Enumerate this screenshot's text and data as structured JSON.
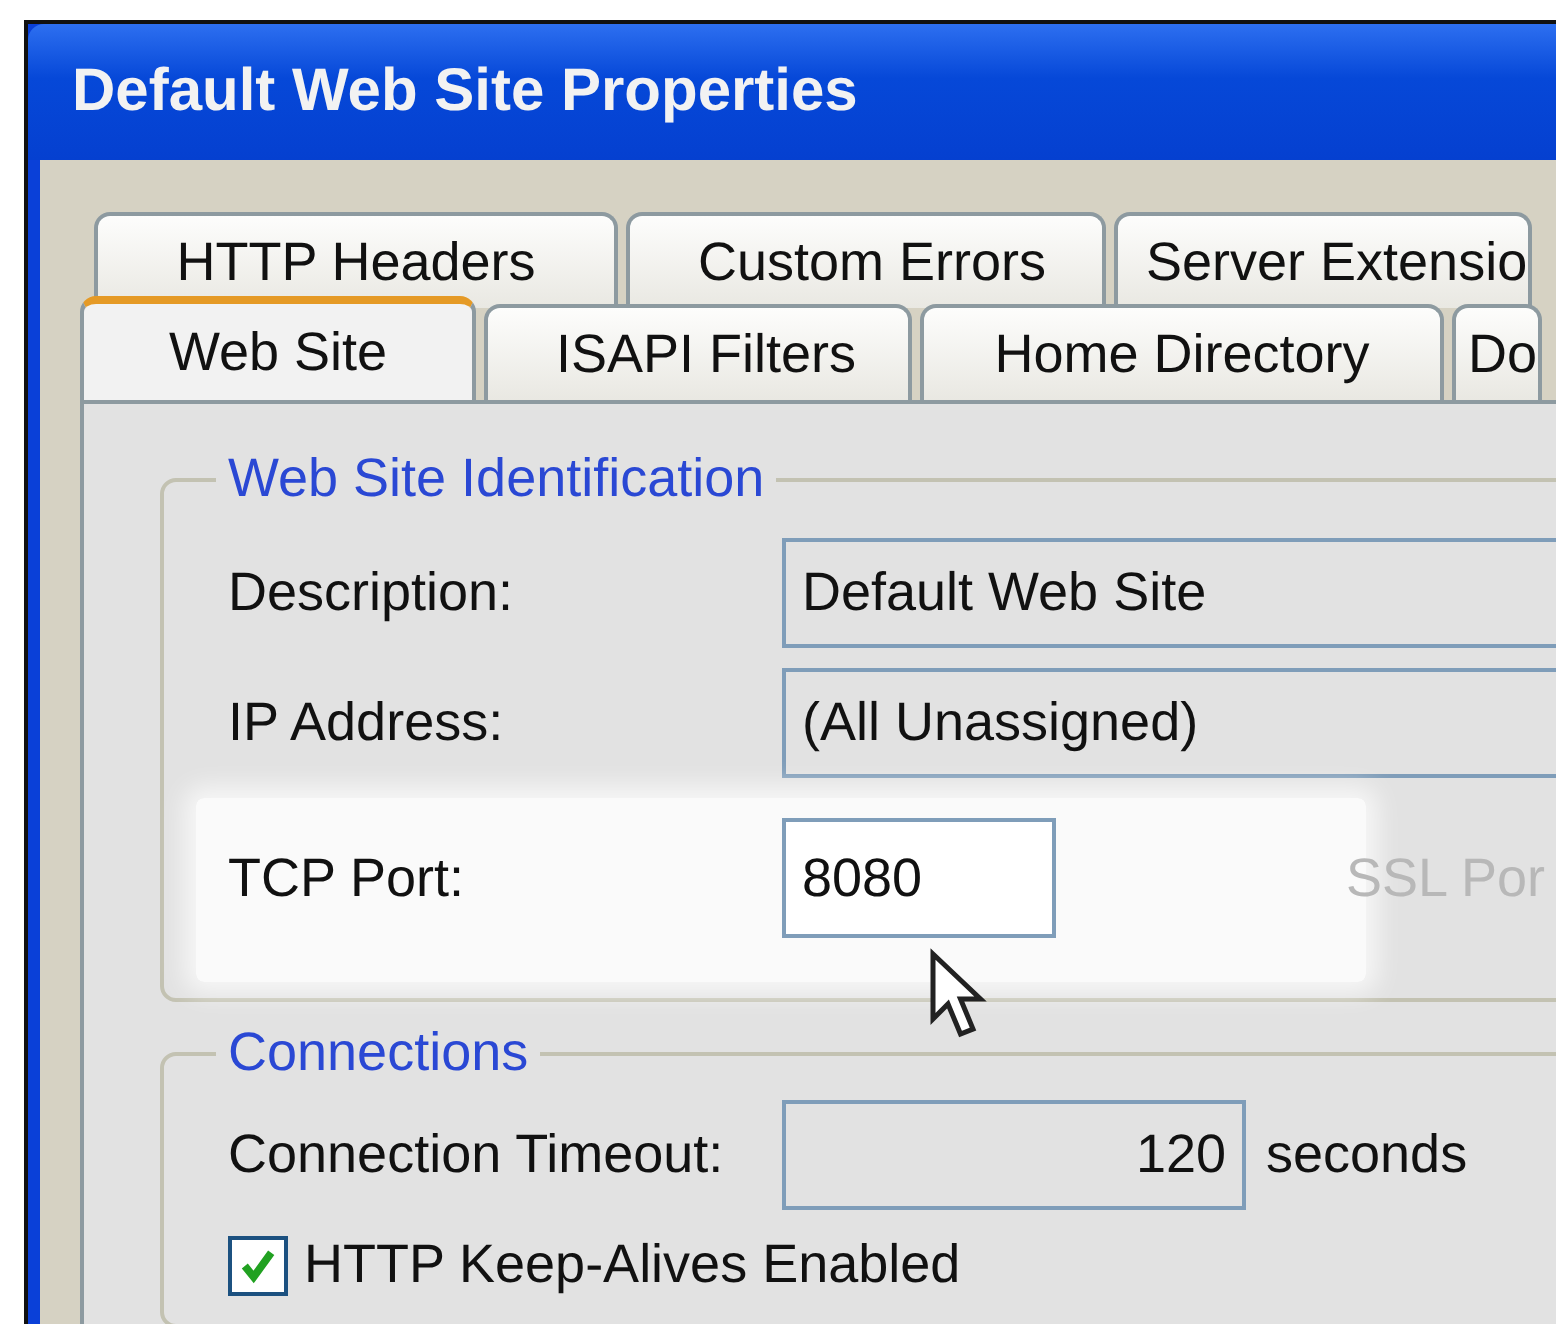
{
  "window": {
    "title": "Default Web Site Properties"
  },
  "tab_rows": [
    [
      {
        "label": "HTTP Headers",
        "selected": false
      },
      {
        "label": "Custom Errors",
        "selected": false
      },
      {
        "label": "Server Extensio",
        "selected": false
      }
    ],
    [
      {
        "label": "Web Site",
        "selected": true
      },
      {
        "label": "ISAPI Filters",
        "selected": false
      },
      {
        "label": "Home Directory",
        "selected": false
      },
      {
        "label": "Do",
        "selected": false
      }
    ]
  ],
  "identification": {
    "legend": "Web Site Identification",
    "fields": [
      {
        "label": "Description:",
        "value": "Default Web Site",
        "kind": "wide"
      },
      {
        "label": "IP Address:",
        "value": "(All Unassigned)",
        "kind": "wide"
      },
      {
        "label": "TCP Port:",
        "value": "8080",
        "kind": "short",
        "highlighted": true,
        "side_label": "SSL Por"
      }
    ]
  },
  "connections": {
    "legend": "Connections",
    "timeout": {
      "label": "Connection Timeout:",
      "value": "120",
      "unit": "seconds"
    },
    "keep_alive": {
      "label": "HTTP Keep-Alives Enabled",
      "checked": true
    }
  }
}
